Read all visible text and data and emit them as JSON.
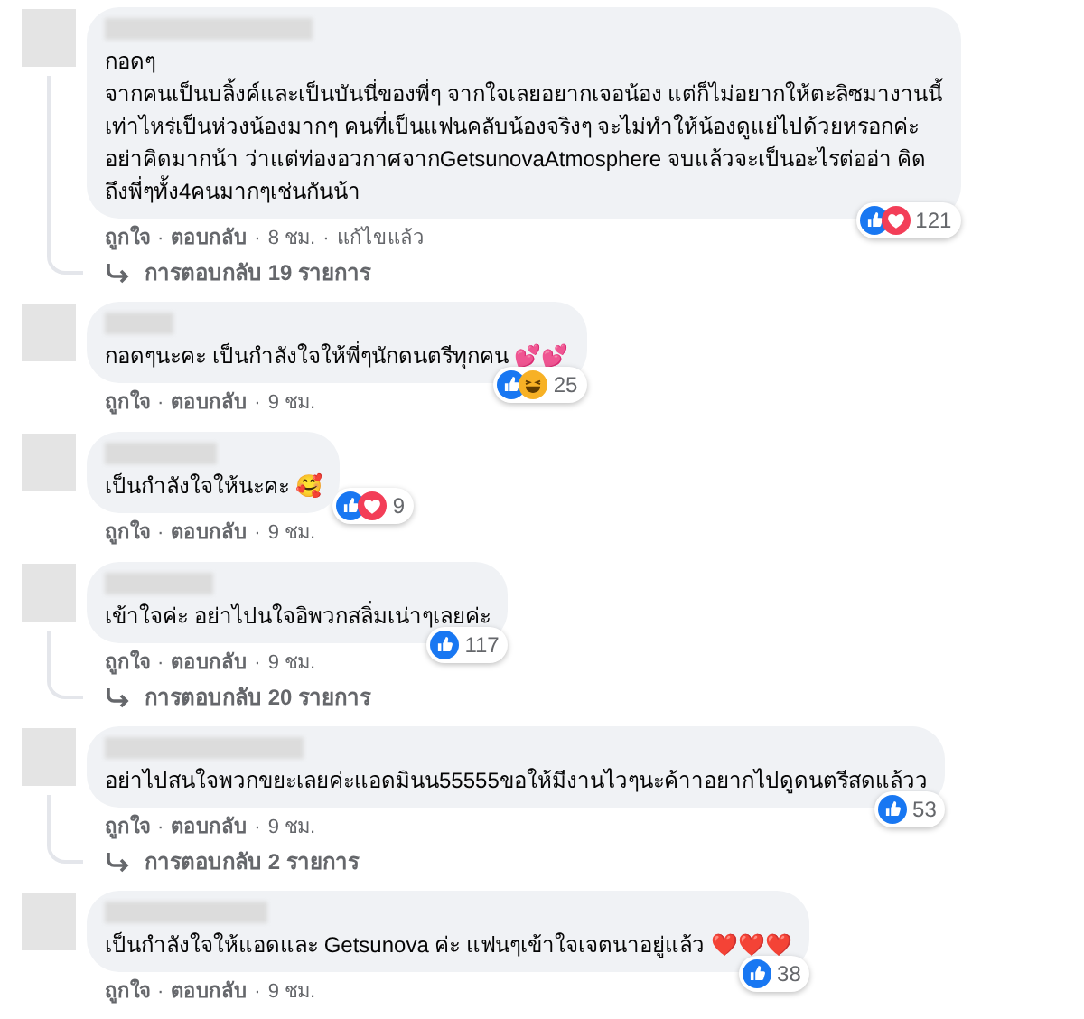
{
  "separator": "·",
  "comments": [
    {
      "text_lines": [
        "กอดๆ",
        "จากคนเป็นบลิ้งค์และเป็นบันนี่ของพี่ๆ จากใจเลยอยากเจอน้อง แต่ก็ไม่อยากให้ตะลิซมางานนี้",
        "เท่าไหร่เป็นห่วงน้องมากๆ คนที่เป็นแฟนคลับน้องจริงๆ จะไม่ทำให้น้องดูแย่ไปด้วยหรอกค่ะ",
        "อย่าคิดมากน้า ว่าแต่ท่องอวกาศจากGetsunovaAtmosphere จบแล้วจะเป็นอะไรต่ออ่า คิด",
        "ถึงพี่ๆทั้ง4คนมากๆเช่นกันน้า"
      ],
      "reactions": [
        {
          "kind": "like"
        },
        {
          "kind": "love"
        }
      ],
      "reaction_count": "121",
      "actions": [
        "ถูกใจ",
        "ตอบกลับ",
        "8 ชม.",
        "แก้ไขแล้ว"
      ],
      "replies": "การตอบกลับ 19 รายการ"
    },
    {
      "text_lines": [
        "กอดๆนะคะ เป็นกำลังใจให้พี่ๆนักดนตรีทุกคน 💕💕"
      ],
      "reactions": [
        {
          "kind": "like"
        },
        {
          "kind": "haha"
        }
      ],
      "reaction_count": "25",
      "actions": [
        "ถูกใจ",
        "ตอบกลับ",
        "9 ชม."
      ]
    },
    {
      "text_lines": [
        "เป็นกำลังใจให้นะคะ 🥰"
      ],
      "reactions": [
        {
          "kind": "like"
        },
        {
          "kind": "love"
        }
      ],
      "reaction_count": "9",
      "actions": [
        "ถูกใจ",
        "ตอบกลับ",
        "9 ชม."
      ]
    },
    {
      "text_lines": [
        "เข้าใจค่ะ อย่าไปนใจอิพวกสลิ่มเน่าๆเลยค่ะ"
      ],
      "reactions": [
        {
          "kind": "like"
        }
      ],
      "reaction_count": "117",
      "actions": [
        "ถูกใจ",
        "ตอบกลับ",
        "9 ชม."
      ],
      "replies": "การตอบกลับ 20 รายการ"
    },
    {
      "text_lines": [
        "อย่าไปสนใจพวกขยะเลยค่ะแอดมินน55555ขอให้มีงานไวๆนะค้าาอยากไปดูดนตรีสดแล้วว"
      ],
      "reactions": [
        {
          "kind": "like"
        }
      ],
      "reaction_count": "53",
      "actions": [
        "ถูกใจ",
        "ตอบกลับ",
        "9 ชม."
      ],
      "replies": "การตอบกลับ 2 รายการ"
    },
    {
      "text_lines": [
        "เป็นกำลังใจให้แอดและ Getsunova ค่ะ แฟนๆเข้าใจเจตนาอยู่แล้ว ❤️❤️❤️"
      ],
      "reactions": [
        {
          "kind": "like"
        }
      ],
      "reaction_count": "38",
      "actions": [
        "ถูกใจ",
        "ตอบกลับ",
        "9 ชม."
      ]
    }
  ]
}
